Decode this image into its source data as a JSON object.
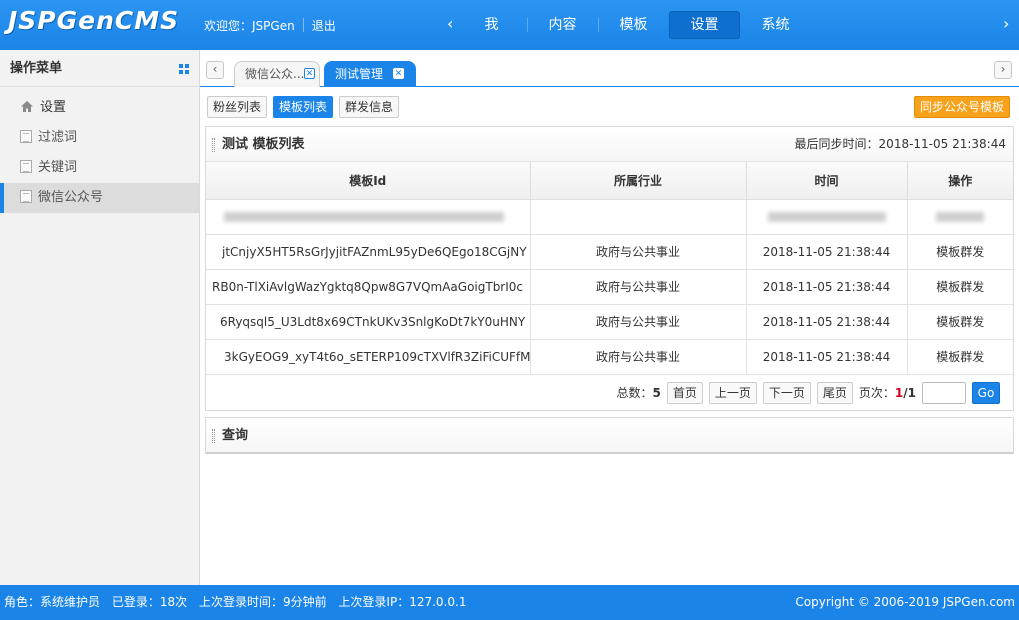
{
  "header": {
    "logo": "JSPGenCMS",
    "welcome": "欢迎您：JSPGen",
    "logout": "退出",
    "nav": [
      {
        "label": "我"
      },
      {
        "label": "内容"
      },
      {
        "label": "模板"
      },
      {
        "label": "设置",
        "active": true
      },
      {
        "label": "系统"
      }
    ],
    "arrow_left": "‹",
    "arrow_right": "›"
  },
  "sidebar": {
    "title": "操作菜单",
    "items": [
      {
        "label": "设置",
        "icon": "home-icon"
      },
      {
        "label": "过滤词",
        "icon": "page-icon"
      },
      {
        "label": "关键词",
        "icon": "page-icon"
      },
      {
        "label": "微信公众号",
        "icon": "page-icon",
        "active": true
      }
    ]
  },
  "tabs": [
    {
      "label": "微信公众..."
    },
    {
      "label": "测试管理",
      "active": true
    }
  ],
  "subtabs": [
    {
      "label": "粉丝列表"
    },
    {
      "label": "模板列表",
      "active": true
    },
    {
      "label": "群发信息"
    }
  ],
  "sync_button": "同步公众号模板",
  "panel": {
    "title": "测试 模板列表",
    "last_sync": "最后同步时间：2018-11-05 21:38:44",
    "columns": [
      "模板Id",
      "所属行业",
      "时间",
      "操作"
    ],
    "rows": [
      {
        "id": "jtCnjyX5HT5RsGrJyjitFAZnmL95yDe6QEgo18CGjNY",
        "industry": "政府与公共事业",
        "time": "2018-11-05 21:38:44",
        "action": "模板群发"
      },
      {
        "id": "RB0n-TlXiAvlgWazYgktq8Qpw8G7VQmAaGoigTbrI0c",
        "industry": "政府与公共事业",
        "time": "2018-11-05 21:38:44",
        "action": "模板群发"
      },
      {
        "id": "6Ryqsql5_U3Ldt8x69CTnkUKv3SnlgKoDt7kY0uHNY",
        "industry": "政府与公共事业",
        "time": "2018-11-05 21:38:44",
        "action": "模板群发"
      },
      {
        "id": "3kGyEOG9_xyT4t6o_sETERP109cTXVlfR3ZiFiCUFfM",
        "industry": "政府与公共事业",
        "time": "2018-11-05 21:38:44",
        "action": "模板群发"
      }
    ]
  },
  "pager": {
    "total_label": "总数：",
    "total": "5",
    "first": "首页",
    "prev": "上一页",
    "next": "下一页",
    "last": "尾页",
    "page_label": "页次：",
    "page_current": "1",
    "page_total": "/1",
    "go": "Go"
  },
  "query": {
    "title": "查询"
  },
  "footer": {
    "role": "角色：系统维护员",
    "logins": "已登录：18次",
    "last_time": "上次登录时间：9分钟前",
    "last_ip": "上次登录IP：127.0.0.1",
    "copyright": "Copyright © 2006-2019 JSPGen.com"
  },
  "colors": {
    "primary": "#1a84e8",
    "accent": "#f7a21a",
    "page_current": "#d9001b"
  }
}
